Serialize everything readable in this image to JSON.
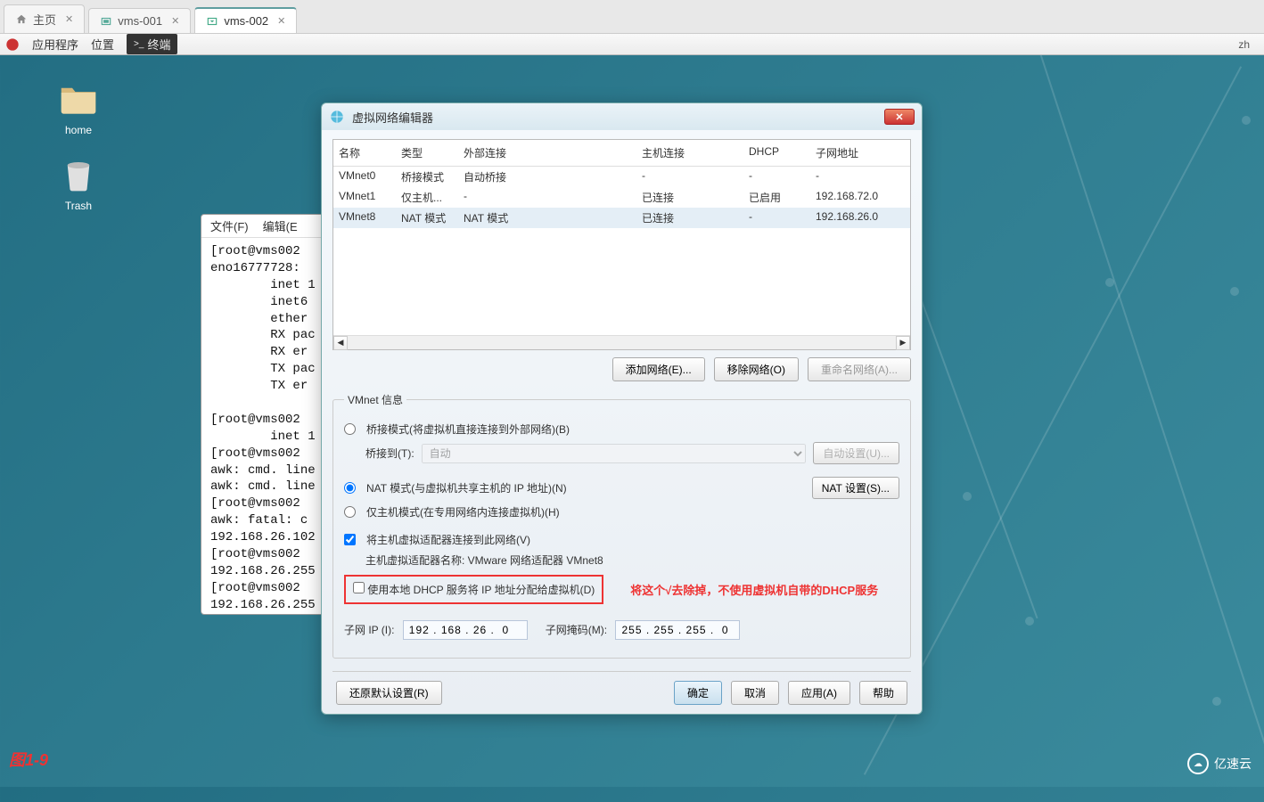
{
  "tabs": [
    {
      "label": "主页",
      "icon": "home"
    },
    {
      "label": "vms-001",
      "icon": "vm"
    },
    {
      "label": "vms-002",
      "icon": "vm"
    }
  ],
  "active_tab": 2,
  "menubar": {
    "apps": "应用程序",
    "location": "位置",
    "terminal": "终端",
    "lang": "zh"
  },
  "desktop": {
    "home": "home",
    "trash": "Trash"
  },
  "terminal": {
    "menu": {
      "file": "文件(F)",
      "edit": "编辑(E"
    },
    "body": "[root@vms002 \neno16777728:\n        inet 1\n        inet6 \n        ether \n        RX pac\n        RX er\n        TX pac\n        TX er\n\n[root@vms002 \n        inet 1\n[root@vms002 \nawk: cmd. line\nawk: cmd. line\n[root@vms002 \nawk: fatal: c\n192.168.26.102\n[root@vms002 \n192.168.26.255\n[root@vms002 \n192.168.26.255\n[root@vms002 "
  },
  "dialog": {
    "title": "虚拟网络编辑器",
    "columns": {
      "name": "名称",
      "type": "类型",
      "ext": "外部连接",
      "host": "主机连接",
      "dhcp": "DHCP",
      "subnet": "子网地址"
    },
    "rows": [
      {
        "name": "VMnet0",
        "type": "桥接模式",
        "ext": "自动桥接",
        "host": "-",
        "dhcp": "-",
        "subnet": "-"
      },
      {
        "name": "VMnet1",
        "type": "仅主机...",
        "ext": "-",
        "host": "已连接",
        "dhcp": "已启用",
        "subnet": "192.168.72.0"
      },
      {
        "name": "VMnet8",
        "type": "NAT 模式",
        "ext": "NAT 模式",
        "host": "已连接",
        "dhcp": "-",
        "subnet": "192.168.26.0"
      }
    ],
    "btn_add": "添加网络(E)...",
    "btn_remove": "移除网络(O)",
    "btn_rename": "重命名网络(A)...",
    "legend": "VMnet 信息",
    "opt_bridge": "桥接模式(将虚拟机直接连接到外部网络)(B)",
    "lbl_bridge_to": "桥接到(T):",
    "sel_bridge": "自动",
    "btn_auto": "自动设置(U)...",
    "opt_nat": "NAT 模式(与虚拟机共享主机的 IP 地址)(N)",
    "btn_nat": "NAT 设置(S)...",
    "opt_hostonly": "仅主机模式(在专用网络内连接虚拟机)(H)",
    "chk_host_adapter": "将主机虚拟适配器连接到此网络(V)",
    "lbl_adapter_name": "主机虚拟适配器名称: VMware 网络适配器 VMnet8",
    "chk_dhcp": "使用本地 DHCP 服务将 IP 地址分配给虚拟机(D)",
    "annotation": "将这个√去除掉，不使用虚拟机自带的DHCP服务",
    "lbl_subnet_ip": "子网 IP (I):",
    "val_subnet_ip": "192 . 168 . 26 .  0",
    "lbl_subnet_mask": "子网掩码(M):",
    "val_subnet_mask": "255 . 255 . 255 .  0",
    "btn_restore": "还原默认设置(R)",
    "btn_ok": "确定",
    "btn_cancel": "取消",
    "btn_apply": "应用(A)",
    "btn_help": "帮助"
  },
  "figure_label": "图1-9",
  "brand": "亿速云"
}
